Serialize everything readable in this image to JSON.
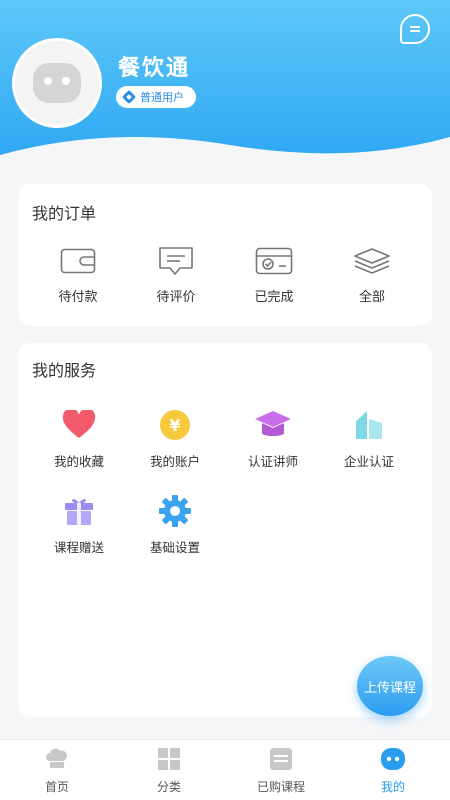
{
  "header": {
    "username": "餐饮通",
    "user_level": "普通用户",
    "message_icon": "chat-bubble-icon"
  },
  "orders": {
    "title": "我的订单",
    "items": [
      {
        "label": "待付款",
        "icon": "wallet-icon"
      },
      {
        "label": "待评价",
        "icon": "comment-icon"
      },
      {
        "label": "已完成",
        "icon": "completed-card-icon"
      },
      {
        "label": "全部",
        "icon": "layers-icon"
      }
    ]
  },
  "services": {
    "title": "我的服务",
    "items": [
      {
        "label": "我的收藏",
        "icon": "heart-icon",
        "color": "#f25a6c"
      },
      {
        "label": "我的账户",
        "icon": "yen-coin-icon",
        "color": "#f7c93c"
      },
      {
        "label": "认证讲师",
        "icon": "graduation-cap-icon",
        "color": "#c86ee8"
      },
      {
        "label": "企业认证",
        "icon": "building-icon",
        "color": "#7fd8e6"
      },
      {
        "label": "课程赠送",
        "icon": "gift-icon",
        "color": "#9b8cf5"
      },
      {
        "label": "基础设置",
        "icon": "gear-icon",
        "color": "#3aa3f0"
      }
    ]
  },
  "upload_button": "上传课程",
  "tabbar": {
    "active_color": "#2a9df0",
    "items": [
      {
        "label": "首页",
        "icon": "chef-hat-icon"
      },
      {
        "label": "分类",
        "icon": "grid-icon"
      },
      {
        "label": "已购课程",
        "icon": "course-list-icon"
      },
      {
        "label": "我的",
        "icon": "robot-face-icon",
        "active": true
      }
    ]
  }
}
